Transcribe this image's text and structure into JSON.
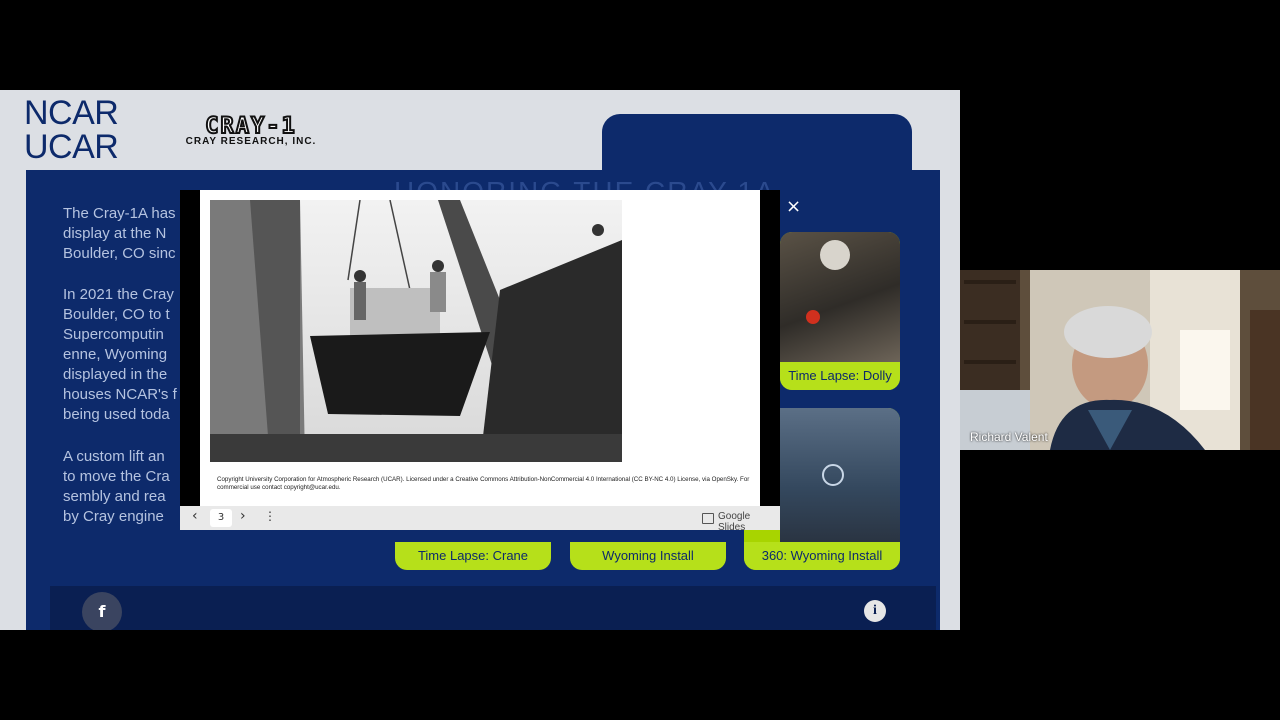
{
  "slide": {
    "logo_lines": [
      "NCAR",
      "UCAR"
    ],
    "cray_logo": "CRAY-1",
    "cray_sub": "CRAY RESEARCH, INC.",
    "headline": "HONORING THE CRAY-1A",
    "paragraphs": [
      "The Cray-1A has\ndisplay at the N\nBoulder, CO sinc",
      "In 2021 the Cray\nBoulder, CO to t\nSupercomputin\nenne, Wyoming\ndisplayed in the\nhouses NCAR's f\nbeing used toda",
      "A custom lift an\nto move the Cra\nsembly and rea\nby Cray engine"
    ],
    "thumbnails": [
      {
        "caption": "Time Lapse: Dolly"
      },
      {
        "caption": "Time Lapse: Crane"
      },
      {
        "caption": "Wyoming Install"
      },
      {
        "caption": "360: Wyoming Install"
      }
    ],
    "footer_icons": [
      "facebook-icon",
      "info-icon"
    ]
  },
  "viewer": {
    "caption": "Copyright University Corporation for Atmospheric Research (UCAR). Licensed under a Creative Commons Attribution-NonCommercial 4.0 International (CC BY-NC 4.0) License, via OpenSky. For commercial use contact copyright@ucar.edu.",
    "close_glyph": "×",
    "page_number": "3",
    "prev_glyph": "‹",
    "next_glyph": "›",
    "menu_glyph": "⋮",
    "brand": "Google Slides"
  },
  "participant": {
    "name": "Richard Valent"
  },
  "colors": {
    "ncar_blue": "#0d2a6b",
    "lime": "#b6e01a"
  }
}
